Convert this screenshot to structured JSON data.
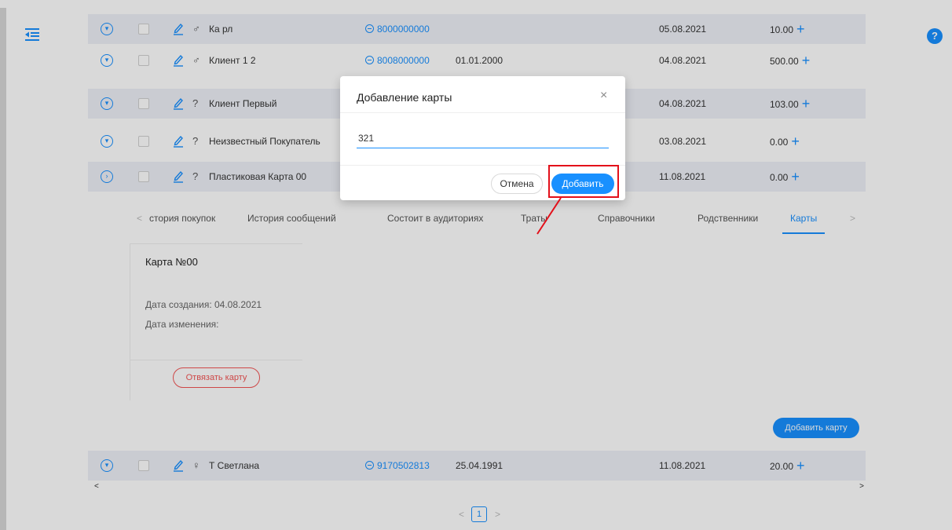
{
  "rows_top": [
    {
      "name": "Ка рл",
      "gender": "♂",
      "phone": "8000000000",
      "birth": "",
      "date": "05.08.2021",
      "amount": "10.00"
    },
    {
      "name": "Клиент 1 2",
      "gender": "♂",
      "phone": "8008000000",
      "birth": "01.01.2000",
      "date": "04.08.2021",
      "amount": "500.00"
    },
    {
      "name": "Клиент Первый",
      "gender": "?",
      "phone": "",
      "birth": "",
      "date": "04.08.2021",
      "amount": "103.00"
    },
    {
      "name": "Неизвестный Покупатель",
      "gender": "?",
      "phone": "",
      "birth": "",
      "date": "03.08.2021",
      "amount": "0.00"
    },
    {
      "name": "Пластиковая Карта 00",
      "gender": "?",
      "phone": "",
      "birth": "",
      "date": "11.08.2021",
      "amount": "0.00"
    }
  ],
  "row_bottom": {
    "name": "Т Светлана",
    "gender": "♀",
    "phone": "9170502813",
    "birth": "25.04.1991",
    "date": "11.08.2021",
    "amount": "20.00"
  },
  "tabs": {
    "items": [
      "стория покупок",
      "История сообщений",
      "Состоит в аудиториях",
      "Траты",
      "Справочники",
      "Родственники",
      "Карты"
    ],
    "active": "Карты",
    "prev_arrow": "<",
    "next_arrow": ">"
  },
  "card": {
    "title": "Карта №00",
    "created": "Дата создания: 04.08.2021",
    "modified": "Дата изменения:",
    "unlink_label": "Отвязать карту"
  },
  "add_card_label": "Добавить карту",
  "pagination": {
    "prev": "<",
    "page": "1",
    "next": ">"
  },
  "scroll": {
    "left": "<",
    "right": ">"
  },
  "help_label": "?",
  "plus_symbol": "+",
  "modal": {
    "title": "Добавление карты",
    "close": "×",
    "input_value": "321",
    "cancel_label": "Отмена",
    "confirm_label": "Добавить"
  },
  "colors": {
    "accent": "#1890ff",
    "danger": "#f25555",
    "highlight": "#e3101a",
    "row_shade": "#eef0f7"
  }
}
